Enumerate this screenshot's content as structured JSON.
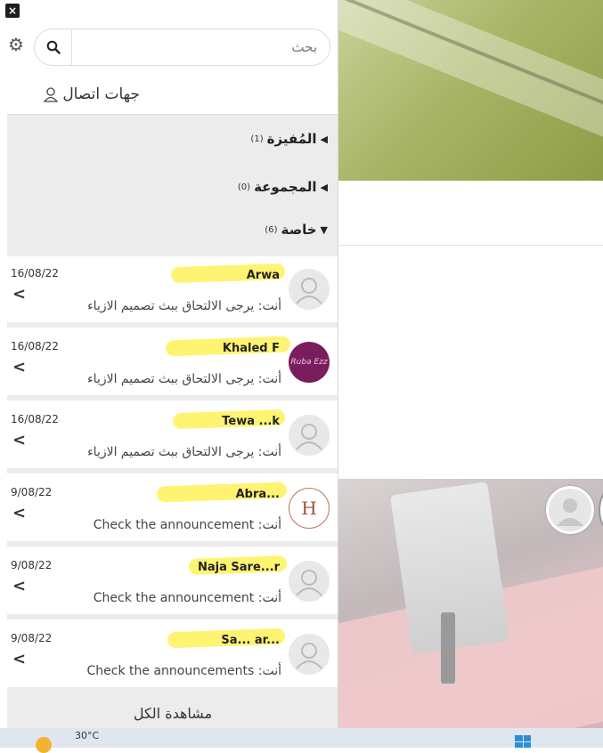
{
  "drawer": {
    "close_label": "×",
    "search": {
      "placeholder": "بحث"
    },
    "contacts_title": "جهات اتصال",
    "groups": [
      {
        "label": "المُفيزة",
        "count": "(1)",
        "expanded": false
      },
      {
        "label": "المجموعة",
        "count": "(0)",
        "expanded": false
      },
      {
        "label": "خاصة",
        "count": "(6)",
        "expanded": true
      }
    ],
    "conversations": [
      {
        "date": "16/08/22",
        "name": "Arwa",
        "message": "أنت: يرجى الالتحاق ببث تصميم الازياء",
        "avatar": "default"
      },
      {
        "date": "16/08/22",
        "name": "Khaled F",
        "message": "أنت: يرجى الالتحاق ببث تصميم الازياء",
        "avatar": "purple",
        "avatar_text": "Ruba Ezz"
      },
      {
        "date": "16/08/22",
        "name": "Tewa ...k",
        "message": "أنت: يرجى الالتحاق ببث تصميم الازياء",
        "avatar": "default"
      },
      {
        "date": "9/08/22",
        "name": "Abra...",
        "message": "أنت: Check the announcement",
        "avatar": "logo",
        "avatar_text": "H"
      },
      {
        "date": "9/08/22",
        "name": "Naja Sare...r",
        "message": "أنت: Check the announcement",
        "avatar": "default"
      },
      {
        "date": "9/08/22",
        "name": "Sa... ar...",
        "message": "أنت: Check the announcements",
        "avatar": "default"
      }
    ],
    "see_all_label": "مشاهدة الكل"
  },
  "taskbar": {
    "temperature": "30°C"
  }
}
